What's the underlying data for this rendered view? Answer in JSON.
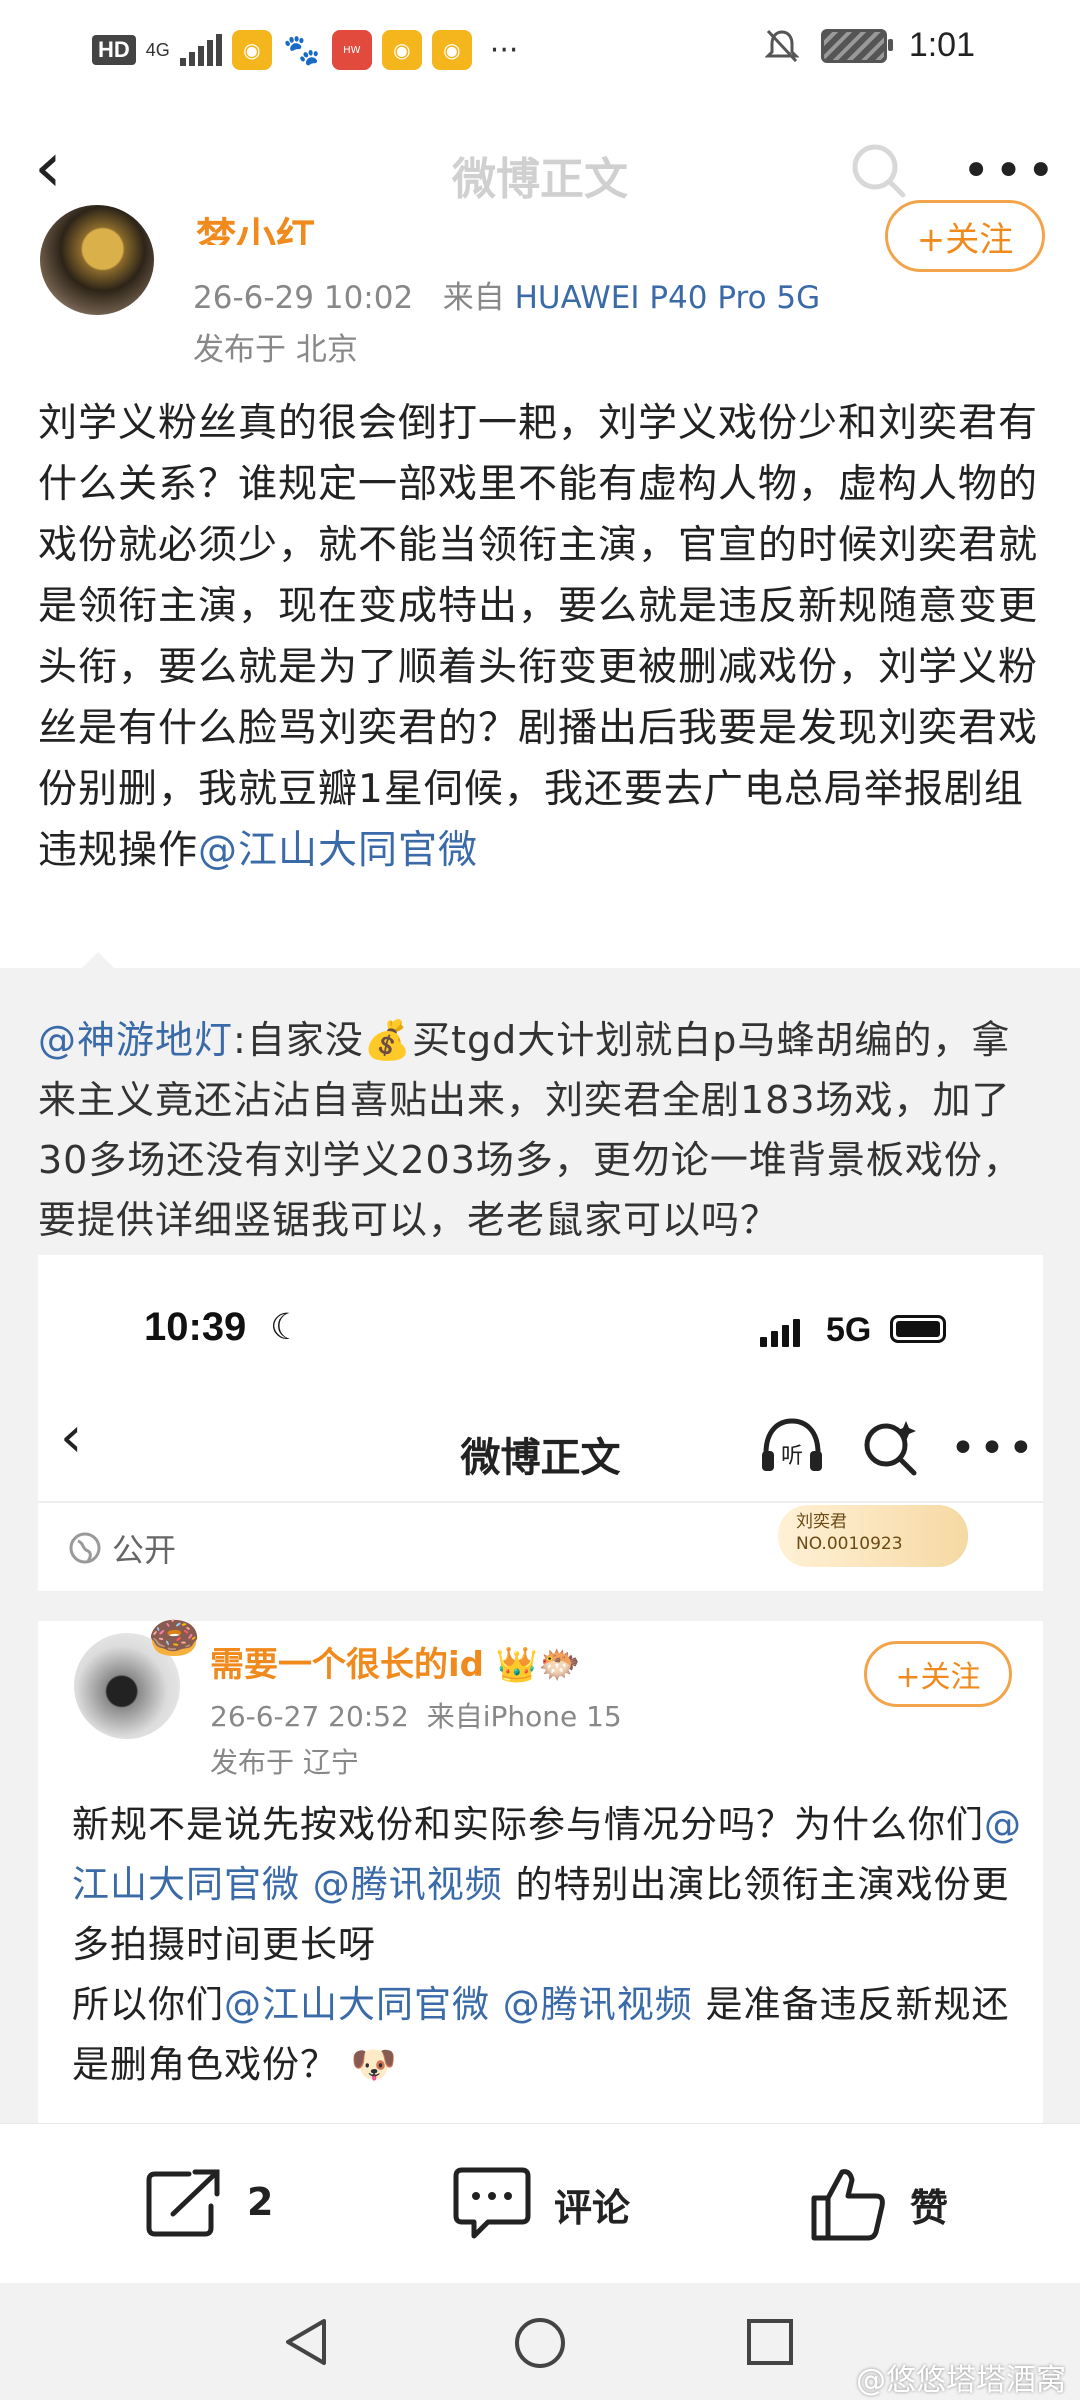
{
  "status_bar": {
    "hd": "HD",
    "network": "4G",
    "time": "1:01",
    "notification_icons": [
      "weibo-icon",
      "baidu-icon",
      "huawei-icon",
      "weibo-icon",
      "weibo-icon"
    ],
    "more": "···"
  },
  "nav": {
    "title": "微博正文"
  },
  "post": {
    "author_name": "梦小红",
    "follow_label": "+关注",
    "time": "26-6-29 10:02",
    "from_label": "来自",
    "device": "HUAWEI P40 Pro 5G",
    "location": "发布于 北京",
    "body": "刘学义粉丝真的很会倒打一耙，刘学义戏份少和刘奕君有什么关系？谁规定一部戏里不能有虚构人物，虚构人物的戏份就必须少，就不能当领衔主演，官宣的时候刘奕君就是领衔主演，现在变成特出，要么就是违反新规随意变更头衔，要么就是为了顺着头衔变更被删减戏份，刘学义粉丝是有什么脸骂刘奕君的？剧播出后我要是发现刘奕君戏份别删，我就豆瓣1星伺候，我还要去广电总局举报剧组违规操作",
    "mention": "@江山大同官微"
  },
  "comment": {
    "user": "@神游地灯",
    "text_a": ":自家没",
    "emoji": "💰",
    "text_b": "买tgd大计划就白p马蜂胡编的，拿来主义竟还沾沾自喜贴出来，刘奕君全剧183场戏，加了30多场还没有刘学义203场多，更勿论一堆背景板戏份，要提供详细竖锯我可以，老老鼠家可以吗？"
  },
  "embedded": {
    "time": "10:39",
    "network": "5G",
    "title": "微博正文",
    "visibility": "公开",
    "badge_name": "刘奕君",
    "badge_no": "NO.0010923",
    "author_name": "需要一个很长的id",
    "follow_label": "+关注",
    "post_time": "26-6-27 20:52",
    "from": "来自iPhone 15",
    "location": "发布于 辽宁",
    "line1": "新规不是说先按戏份和实际参与情况分吗？为什么你们",
    "mention1": "@江山大同官微",
    "mention2": "@腾讯视频",
    "line2": "的特别出演比领衔主演戏份更多拍摄时间更长呀",
    "line3": "所以你们",
    "mention3": "@江山大同官微",
    "mention4": "@腾讯视频",
    "line4": "是准备违反新规还是删角色戏份？",
    "emoji": "🐶"
  },
  "actions": {
    "share_count": "2",
    "comment_label": "评论",
    "like_label": "赞"
  },
  "watermark": "@悠悠塔塔酒窝"
}
